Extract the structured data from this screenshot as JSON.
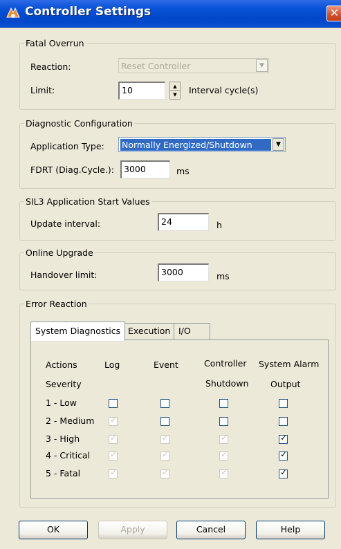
{
  "window": {
    "title": "Controller Settings",
    "close_glyph": "✕"
  },
  "fatal_overrun": {
    "legend": "Fatal Overrun",
    "reaction_label": "Reaction:",
    "reaction_value": "Reset Controller",
    "limit_label": "Limit:",
    "limit_value": "10",
    "limit_unit": "Interval cycle(s)"
  },
  "diagnostic": {
    "legend": "Diagnostic Configuration",
    "app_type_label": "Application Type:",
    "app_type_value": "Normally Energized/Shutdown",
    "fdrt_label": "FDRT (Diag.Cycle.):",
    "fdrt_value": "3000",
    "fdrt_unit": "ms"
  },
  "sil3": {
    "legend": "SIL3 Application Start Values",
    "update_label": "Update interval:",
    "update_value": "24",
    "update_unit": "h"
  },
  "online_upgrade": {
    "legend": "Online Upgrade",
    "handover_label": "Handover limit:",
    "handover_value": "3000",
    "handover_unit": "ms"
  },
  "error_reaction": {
    "legend": "Error Reaction",
    "tabs": [
      "System Diagnostics",
      "Execution",
      "I/O"
    ],
    "headers": {
      "actions": "Actions",
      "severity": "Severity",
      "log": "Log",
      "event": "Event",
      "controller_1": "Controller",
      "controller_2": "Shutdown",
      "alarm_1": "System Alarm",
      "alarm_2": "Output"
    },
    "rows": [
      {
        "label": "1 - Low",
        "log": false,
        "event": false,
        "shutdown": false,
        "alarm": false,
        "log_disabled": false,
        "event_disabled": false,
        "shutdown_disabled": false
      },
      {
        "label": "2 - Medium",
        "log": true,
        "event": false,
        "shutdown": false,
        "alarm": false,
        "log_disabled": true,
        "event_disabled": false,
        "shutdown_disabled": false
      },
      {
        "label": "3 - High",
        "log": true,
        "event": true,
        "shutdown": true,
        "alarm": true,
        "log_disabled": true,
        "event_disabled": true,
        "shutdown_disabled": true
      },
      {
        "label": "4 - Critical",
        "log": true,
        "event": true,
        "shutdown": true,
        "alarm": true,
        "log_disabled": true,
        "event_disabled": true,
        "shutdown_disabled": true
      },
      {
        "label": "5 - Fatal",
        "log": true,
        "event": true,
        "shutdown": true,
        "alarm": true,
        "log_disabled": true,
        "event_disabled": true,
        "shutdown_disabled": true
      }
    ]
  },
  "buttons": {
    "ok": "OK",
    "apply": "Apply",
    "cancel": "Cancel",
    "help": "Help"
  },
  "icons": {
    "dropdown": "chevron-down-icon",
    "spin_up": "▲",
    "spin_down": "▼",
    "check": "✓"
  },
  "colors": {
    "titlebar": "#0046C8",
    "dialog_bg": "#ECE9D8",
    "selection": "#316AC5"
  }
}
